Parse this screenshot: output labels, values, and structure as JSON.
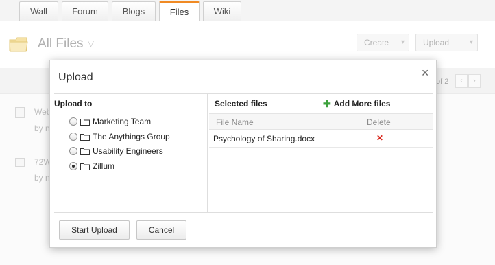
{
  "tabs": [
    {
      "label": "Wall",
      "active": false
    },
    {
      "label": "Forum",
      "active": false
    },
    {
      "label": "Blogs",
      "active": false
    },
    {
      "label": "Files",
      "active": true
    },
    {
      "label": "Wiki",
      "active": false
    }
  ],
  "header": {
    "title": "All Files",
    "create_label": "Create",
    "upload_label": "Upload"
  },
  "pager": {
    "text": "of 2"
  },
  "background_items": [
    {
      "name": "Web",
      "meta": "by n"
    },
    {
      "name": "72W",
      "meta": "by n"
    }
  ],
  "modal": {
    "title": "Upload",
    "upload_to_heading": "Upload to",
    "groups": [
      {
        "label": "Marketing Team",
        "selected": false
      },
      {
        "label": "The Anythings Group",
        "selected": false
      },
      {
        "label": "Usability Engineers",
        "selected": false
      },
      {
        "label": "Zillum",
        "selected": true
      }
    ],
    "selected_heading": "Selected files",
    "add_more_label": "Add More files",
    "columns": {
      "file_name": "File Name",
      "delete": "Delete"
    },
    "files": [
      {
        "name": "Psychology of Sharing.docx"
      }
    ],
    "start_upload_label": "Start Upload",
    "cancel_label": "Cancel"
  },
  "colors": {
    "active_tab_accent": "#f08a24",
    "add_icon": "#3ba13b",
    "delete_icon": "#d9261c"
  },
  "icons": [
    "folder-icon",
    "close-icon",
    "plus-icon",
    "delete-icon",
    "chevron-down-icon",
    "chevron-left-icon",
    "chevron-right-icon"
  ]
}
